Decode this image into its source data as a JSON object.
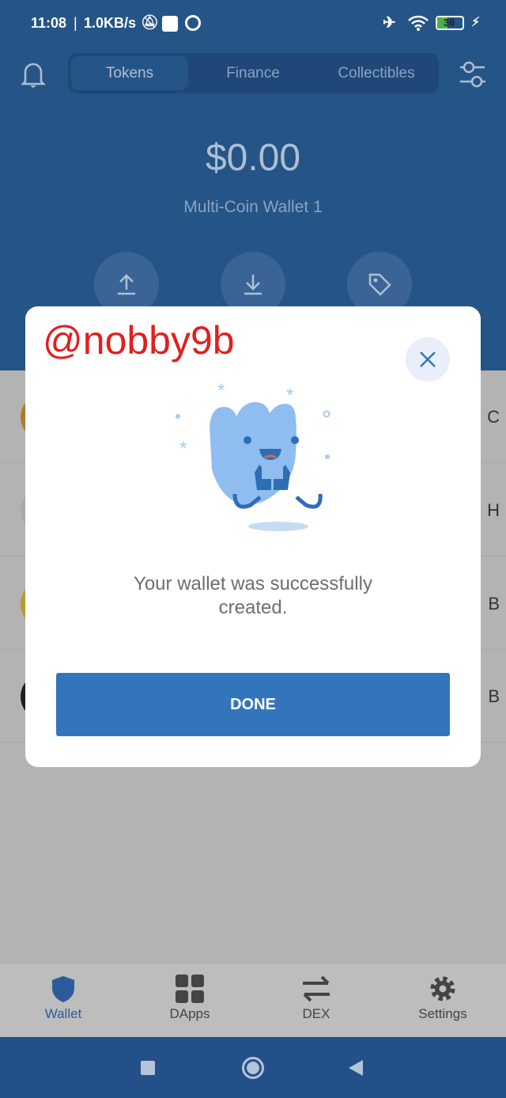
{
  "status_bar": {
    "time": "11:08",
    "speed": "1.0KB/s",
    "battery": "36"
  },
  "header": {
    "tabs": [
      {
        "label": "Tokens",
        "active": true
      },
      {
        "label": "Finance"
      },
      {
        "label": "Collectibles"
      }
    ],
    "balance": "$0.00",
    "wallet_name": "Multi-Coin Wallet 1"
  },
  "tokens": [
    {
      "ticker_partial": "C",
      "color": "#b07a2a"
    },
    {
      "ticker_partial": "H",
      "color": "#a8a8a8"
    },
    {
      "ticker_partial": "B",
      "color": "#b89a24"
    },
    {
      "ticker_partial": "B",
      "color": "#1e1e22"
    }
  ],
  "modal": {
    "watermark": "@nobby9b",
    "message": "Your wallet was successfully created.",
    "done_label": "DONE"
  },
  "bottom_nav": [
    {
      "label": "Wallet",
      "icon": "shield-icon",
      "active": true
    },
    {
      "label": "DApps",
      "icon": "grid-icon"
    },
    {
      "label": "DEX",
      "icon": "swap-icon"
    },
    {
      "label": "Settings",
      "icon": "gear-icon"
    }
  ],
  "colors": {
    "accent": "#3375bb",
    "header": "#255487",
    "watermark": "#e0201f"
  }
}
